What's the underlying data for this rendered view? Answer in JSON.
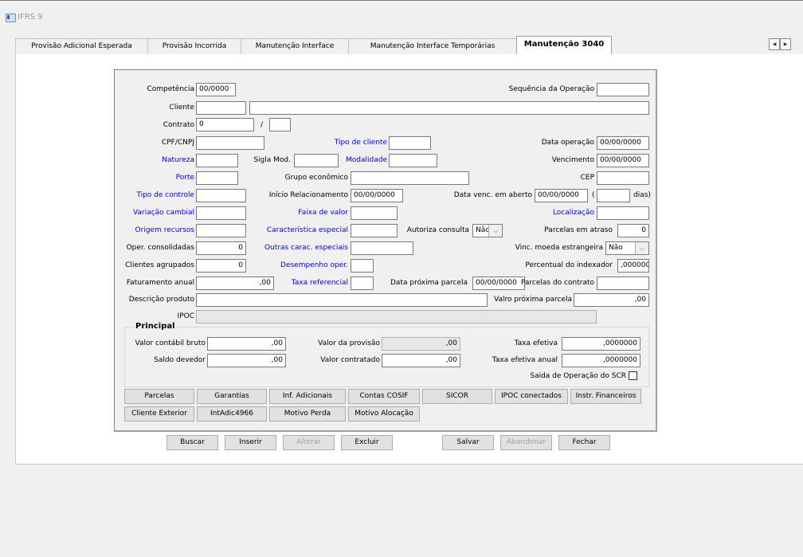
{
  "window": {
    "title": "IFRS 9"
  },
  "tabs": [
    "Provisão Adicional Esperada",
    "Provisão Incorrida",
    "Manutenção Interface",
    "Manutenção Interface Temporárias",
    "Manutenção 3040"
  ],
  "tab_scroll": {
    "left": "◀",
    "right": "▶"
  },
  "form": {
    "competencia": {
      "label": "Competência",
      "value": "00/0000"
    },
    "sequencia": {
      "label": "Sequência da Operação",
      "value": ""
    },
    "cliente": {
      "label": "Cliente",
      "code": "",
      "name": ""
    },
    "contrato": {
      "label": "Contrato",
      "value": "0",
      "sep": "/",
      "suffix": ""
    },
    "cpf": {
      "label": "CPF/CNPJ",
      "value": ""
    },
    "tipo_cliente": {
      "label": "Tipo de cliente",
      "value": ""
    },
    "data_operacao": {
      "label": "Data operação",
      "value": "00/00/0000"
    },
    "natureza": {
      "label": "Natureza",
      "value": ""
    },
    "sigla_mod": {
      "label": "Sigla Mod.",
      "value": ""
    },
    "modalidade": {
      "label": "Modalidade",
      "value": ""
    },
    "vencimento": {
      "label": "Vencimento",
      "value": "00/00/0000"
    },
    "porte": {
      "label": "Porte",
      "value": ""
    },
    "grupo_economico": {
      "label": "Grupo econômico",
      "value": ""
    },
    "cep": {
      "label": "CEP",
      "value": ""
    },
    "tipo_controle": {
      "label": "Tipo de controle",
      "value": ""
    },
    "inicio_relacionamento": {
      "label": "Início Relacionamento",
      "value": "00/00/0000"
    },
    "data_venc_aberto": {
      "label": "Data venc. em aberto",
      "value": "00/00/0000",
      "open_paren": "(",
      "dias_value": "",
      "dias_label": "dias)"
    },
    "variacao_cambial": {
      "label": "Variação cambial",
      "value": ""
    },
    "faixa_valor": {
      "label": "Faixa de valor",
      "value": ""
    },
    "localizacao": {
      "label": "Localização",
      "value": ""
    },
    "origem_recursos": {
      "label": "Origem recursos",
      "value": ""
    },
    "caracteristica_especial": {
      "label": "Característica especial",
      "value": ""
    },
    "autoriza_consulta": {
      "label": "Autoriza consulta",
      "value": "Não"
    },
    "parcelas_atraso": {
      "label": "Parcelas em atraso",
      "value": "0"
    },
    "oper_consolidadas": {
      "label": "Oper. consolidadas",
      "value": "0"
    },
    "outras_carac": {
      "label": "Outras carac. especiais",
      "value": ""
    },
    "vinc_moeda": {
      "label": "Vinc. moeda estrangeira",
      "value": "Não"
    },
    "clientes_agrupados": {
      "label": "Clientes agrupados",
      "value": "0"
    },
    "desempenho_oper": {
      "label": "Desempenho oper.",
      "value": ""
    },
    "percentual_indexador": {
      "label": "Percentual do indexador",
      "value": ",0000000"
    },
    "faturamento_anual": {
      "label": "Faturamento anual",
      "value": ",00"
    },
    "taxa_referencial": {
      "label": "Taxa referencial",
      "value": ""
    },
    "data_proxima_parcela": {
      "label": "Data próxima parcela",
      "value": "00/00/0000"
    },
    "parcelas_contrato": {
      "label": "Parcelas do contrato",
      "value": ""
    },
    "descricao_produto": {
      "label": "Descrição produto",
      "value": ""
    },
    "valor_proxima_parcela": {
      "label": "Valro próxima parcela",
      "value": ",00"
    },
    "ipoc": {
      "label": "IPOC",
      "value": ""
    }
  },
  "principal": {
    "title": "Principal",
    "valor_contabil_bruto": {
      "label": "Valor contábil bruto",
      "value": ",00"
    },
    "valor_provisao": {
      "label": "Valor da provisão",
      "value": ",00"
    },
    "taxa_efetiva": {
      "label": "Taxa efetiva",
      "value": ",0000000"
    },
    "saldo_devedor": {
      "label": "Saldo devedor",
      "value": ",00"
    },
    "valor_contratado": {
      "label": "Valor contratado",
      "value": ",00"
    },
    "taxa_efetiva_anual": {
      "label": "Taxa efetiva anual",
      "value": ",0000000"
    },
    "saida_operacao": {
      "label": "Saida de Operação do SCR",
      "checked": false
    }
  },
  "sub_buttons_row1": [
    "Parcelas",
    "Garantias",
    "Inf. Adicionais",
    "Contas COSIF",
    "SICOR",
    "IPOC conectados",
    "Instr. Financeiros"
  ],
  "sub_buttons_row2": [
    "Cliente Exterior",
    "IntAdic4966",
    "Motivo Perda",
    "Motivo Alocação"
  ],
  "actions": {
    "buscar": "Buscar",
    "inserir": "Inserir",
    "alterar": "Alterar",
    "excluir": "Excluir",
    "salvar": "Salvar",
    "abandonar": "Abandonar",
    "fechar": "Fechar"
  },
  "colors": {
    "link_label": "#0000ee",
    "disabled_text": "#a0a0a0",
    "panel_bg": "#f0f0f0"
  }
}
